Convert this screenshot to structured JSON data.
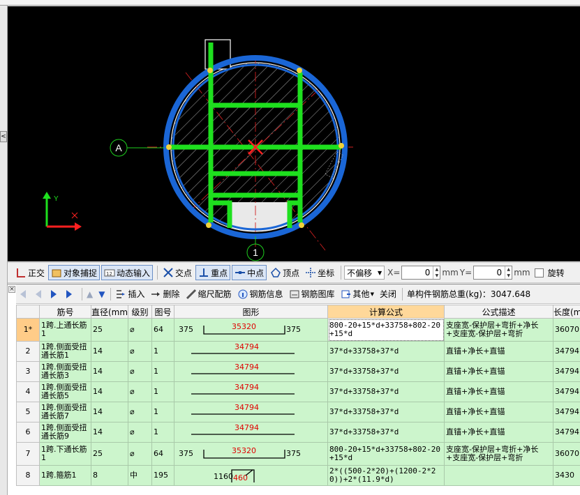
{
  "axis_labels": {
    "grid_a": "A",
    "grid_1": "1",
    "y_axis": "Y"
  },
  "snap_toolbar": {
    "ortho": "正交",
    "object_snap": "对象捕捉",
    "dynamic_input": "动态输入",
    "intersection": "交点",
    "perpendicular": "重点",
    "midpoint": "中点",
    "vertex": "顶点",
    "coordinate": "坐标",
    "offset_mode": "不偏移",
    "x_label": "X=",
    "x_value": "0",
    "y_label": "Y=",
    "y_value": "0",
    "unit": "mm",
    "rotate": "旋转"
  },
  "rebar_toolbar": {
    "insert": "插入",
    "delete": "删除",
    "scale_rebar": "缩尺配筋",
    "rebar_info": "钢筋信息",
    "rebar_library": "钢筋图库",
    "other": "其他",
    "close": "关闭",
    "total_weight_label": "单构件钢筋总重(kg)：3047.648"
  },
  "table": {
    "columns": [
      "",
      "筋号",
      "直径(mm)",
      "级别",
      "图号",
      "图形",
      "计算公式",
      "公式描述",
      "长度(mm)"
    ],
    "rows": [
      {
        "no": "1*",
        "name": "1跨.上通长筋1",
        "dia": "25",
        "grade": "⌀",
        "fig": "64",
        "left": "375",
        "mid": "35320",
        "right": "375",
        "formula": "800-20+15*d+33758+802-20+15*d",
        "desc": "支座宽-保护层+弯折+净长+支座宽-保护层+弯折",
        "length": "36070"
      },
      {
        "no": "2",
        "name": "1跨.侧面受扭通长筋1",
        "dia": "14",
        "grade": "⌀",
        "fig": "1",
        "left": "",
        "mid": "34794",
        "right": "",
        "formula": "37*d+33758+37*d",
        "desc": "直锚+净长+直锚",
        "length": "34794"
      },
      {
        "no": "3",
        "name": "1跨.侧面受扭通长筋3",
        "dia": "14",
        "grade": "⌀",
        "fig": "1",
        "left": "",
        "mid": "34794",
        "right": "",
        "formula": "37*d+33758+37*d",
        "desc": "直锚+净长+直锚",
        "length": "34794"
      },
      {
        "no": "4",
        "name": "1跨.侧面受扭通长筋5",
        "dia": "14",
        "grade": "⌀",
        "fig": "1",
        "left": "",
        "mid": "34794",
        "right": "",
        "formula": "37*d+33758+37*d",
        "desc": "直锚+净长+直锚",
        "length": "34794"
      },
      {
        "no": "5",
        "name": "1跨.侧面受扭通长筋7",
        "dia": "14",
        "grade": "⌀",
        "fig": "1",
        "left": "",
        "mid": "34794",
        "right": "",
        "formula": "37*d+33758+37*d",
        "desc": "直锚+净长+直锚",
        "length": "34794"
      },
      {
        "no": "6",
        "name": "1跨.侧面受扭通长筋9",
        "dia": "14",
        "grade": "⌀",
        "fig": "1",
        "left": "",
        "mid": "34794",
        "right": "",
        "formula": "37*d+33758+37*d",
        "desc": "直锚+净长+直锚",
        "length": "34794"
      },
      {
        "no": "7",
        "name": "1跨.下通长筋1",
        "dia": "25",
        "grade": "⌀",
        "fig": "64",
        "left": "375",
        "mid": "35320",
        "right": "375",
        "formula": "800-20+15*d+33758+802-20+15*d",
        "desc": "支座宽-保护层+弯折+净长+支座宽-保护层+弯折",
        "length": "36070"
      },
      {
        "no": "8",
        "name": "1跨.箍筋1",
        "dia": "8",
        "grade": "中",
        "fig": "195",
        "left": "1160",
        "mid": "460",
        "right": "",
        "formula": "2*((500-2*20)+(1200-2*20))+2*(11.9*d)",
        "desc": "",
        "length": "3430"
      }
    ]
  }
}
